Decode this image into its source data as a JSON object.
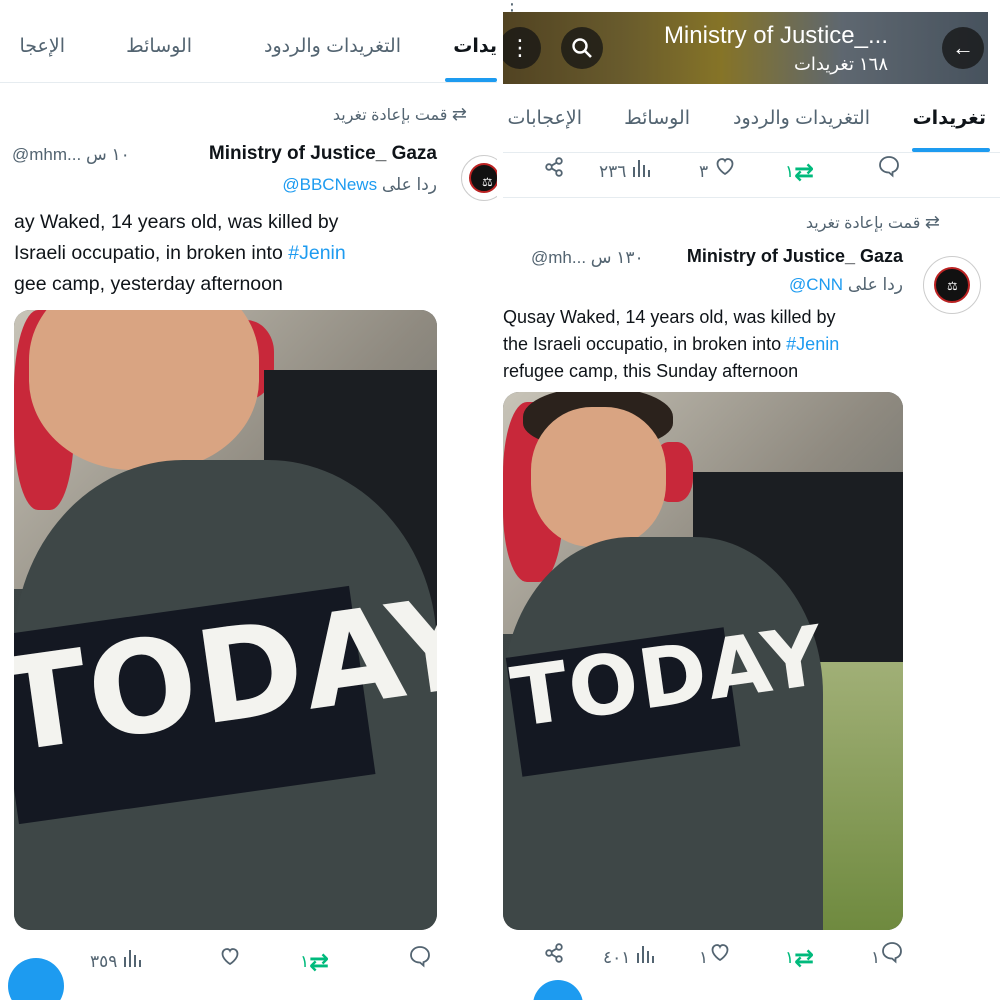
{
  "left": {
    "tabs": [
      "يدات",
      "التغريدات والردود",
      "الوسائط",
      "الإعجا"
    ],
    "retweeted_label": "قمت بإعادة تغريد",
    "tweet": {
      "name": "Ministry of Justice_ Gaza",
      "handle": "@mhm...",
      "time": "١٠ س",
      "reply_prefix": "ردا على",
      "reply_to": "@BBCNews",
      "lines": [
        "ay Waked, 14 years old, was killed by",
        "Israeli occupatio, in broken into ",
        "gee camp, yesterday  afternoon"
      ],
      "hashtag": "#Jenin",
      "photo_text": "TODAY"
    },
    "actions": {
      "replies": "",
      "retweets": "١",
      "likes": "",
      "views": "٣٥٩"
    }
  },
  "right": {
    "header": {
      "title": "Ministry of Justice_...",
      "subtitle": "١٦٨ تغريدات"
    },
    "tabs": [
      "تغريدات",
      "التغريدات والردود",
      "الوسائط",
      "الإعجابات"
    ],
    "prev_actions": {
      "replies": "",
      "retweets": "١",
      "likes": "٣",
      "views": "٢٣٦"
    },
    "retweeted_label": "قمت بإعادة تغريد",
    "tweet": {
      "name": "Ministry of Justice_ Gaza",
      "handle": "@mh...",
      "time": "١٣٠ س",
      "reply_prefix": "ردا على",
      "reply_to": "@CNN",
      "lines": [
        "Qusay Waked, 14 years old, was killed by",
        "the Israeli occupatio, in broken into ",
        "refugee camp, this Sunday afternoon"
      ],
      "hashtag": "#Jenin",
      "photo_text": "TODAY"
    },
    "actions": {
      "replies": "١",
      "retweets": "١",
      "likes": "١",
      "views": "٤٠١"
    }
  },
  "colors": {
    "accent": "#1d9bf0",
    "retweet_green": "#00ba7c",
    "muted": "#536471"
  }
}
